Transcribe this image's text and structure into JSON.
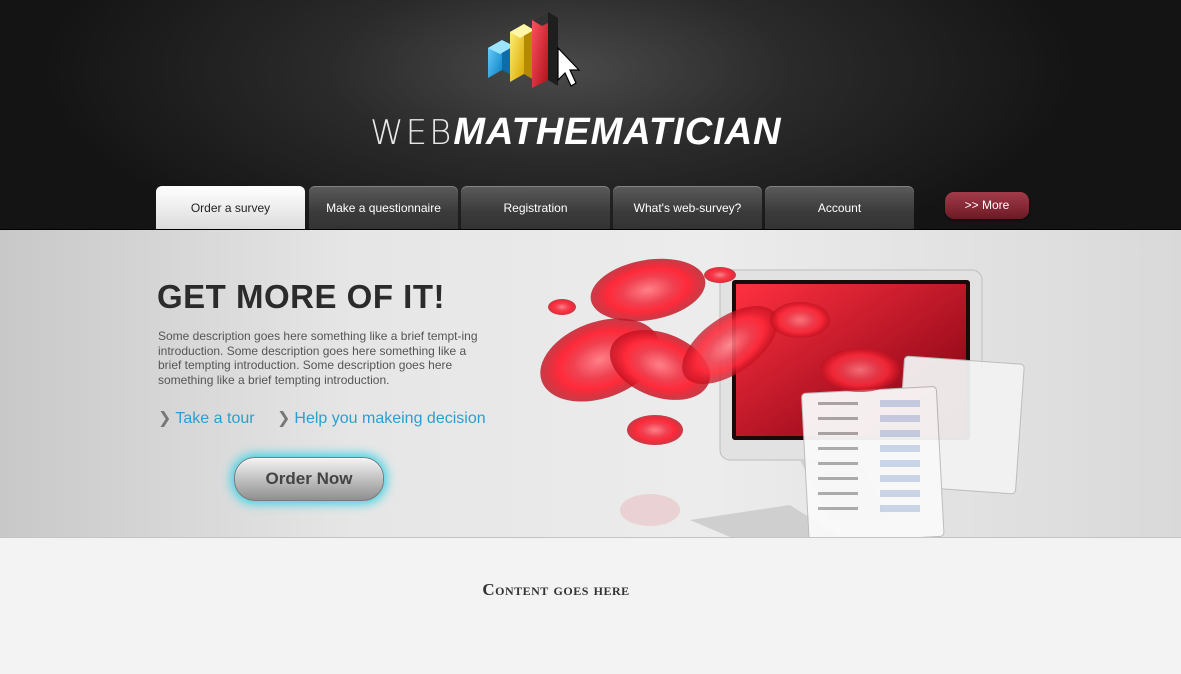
{
  "brand": {
    "logo_thin": "WEB",
    "logo_bold": "MATHEMATICIAN",
    "logo_icon": "bar-chart-cursor-icon"
  },
  "nav": {
    "tabs": [
      {
        "label": "Order a survey",
        "active": true
      },
      {
        "label": "Make a questionnaire",
        "active": false
      },
      {
        "label": "Registration",
        "active": false
      },
      {
        "label": "What's web-survey?",
        "active": false
      },
      {
        "label": "Account",
        "active": false
      }
    ],
    "more_label": ">> More"
  },
  "hero": {
    "title": "GET MORE OF IT!",
    "description": "Some description goes here something like a brief tempt-ing introduction. Some description goes here something like a brief tempting introduction. Some description goes here something like a brief tempting introduction.",
    "link_tour": "Take a tour",
    "link_help": "Help you makeing decision",
    "order_button": "Order Now"
  },
  "content": {
    "heading": "Content goes here"
  },
  "colors": {
    "accent_blue": "#2a9fd0",
    "more_button": "#8a2a36",
    "glow": "#3ed3e6",
    "cell_red": "#e0202e"
  }
}
